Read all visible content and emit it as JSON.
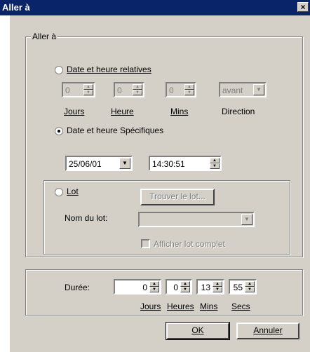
{
  "window": {
    "title": "Aller à",
    "close_glyph": "×"
  },
  "group_main": {
    "legend": "Aller à"
  },
  "relative": {
    "radio_label": "Date et heure relatives",
    "jours_value": "0",
    "heure_value": "0",
    "mins_value": "0",
    "direction_value": "avant",
    "labels": {
      "jours": "Jours",
      "heure": "Heure",
      "mins": "Mins",
      "direction": "Direction"
    }
  },
  "specific": {
    "radio_label": "Date et heure Spécifiques",
    "date_value": "25/06/01",
    "time_value": "14:30:51"
  },
  "lot": {
    "radio_label": "Lot",
    "find_button": "Trouver le lot...",
    "name_label": "Nom du lot:",
    "name_value": "",
    "show_complete": "Afficher lot complet"
  },
  "duration": {
    "label": "Durée:",
    "jours_value": "0",
    "heures_value": "0",
    "mins_value": "13",
    "secs_value": "55",
    "labels": {
      "jours": "Jours",
      "heures": "Heures",
      "mins": "Mins",
      "secs": "Secs"
    }
  },
  "buttons": {
    "ok": "OK",
    "cancel": "Annuler"
  },
  "icons": {
    "up": "▲",
    "down": "▼"
  }
}
